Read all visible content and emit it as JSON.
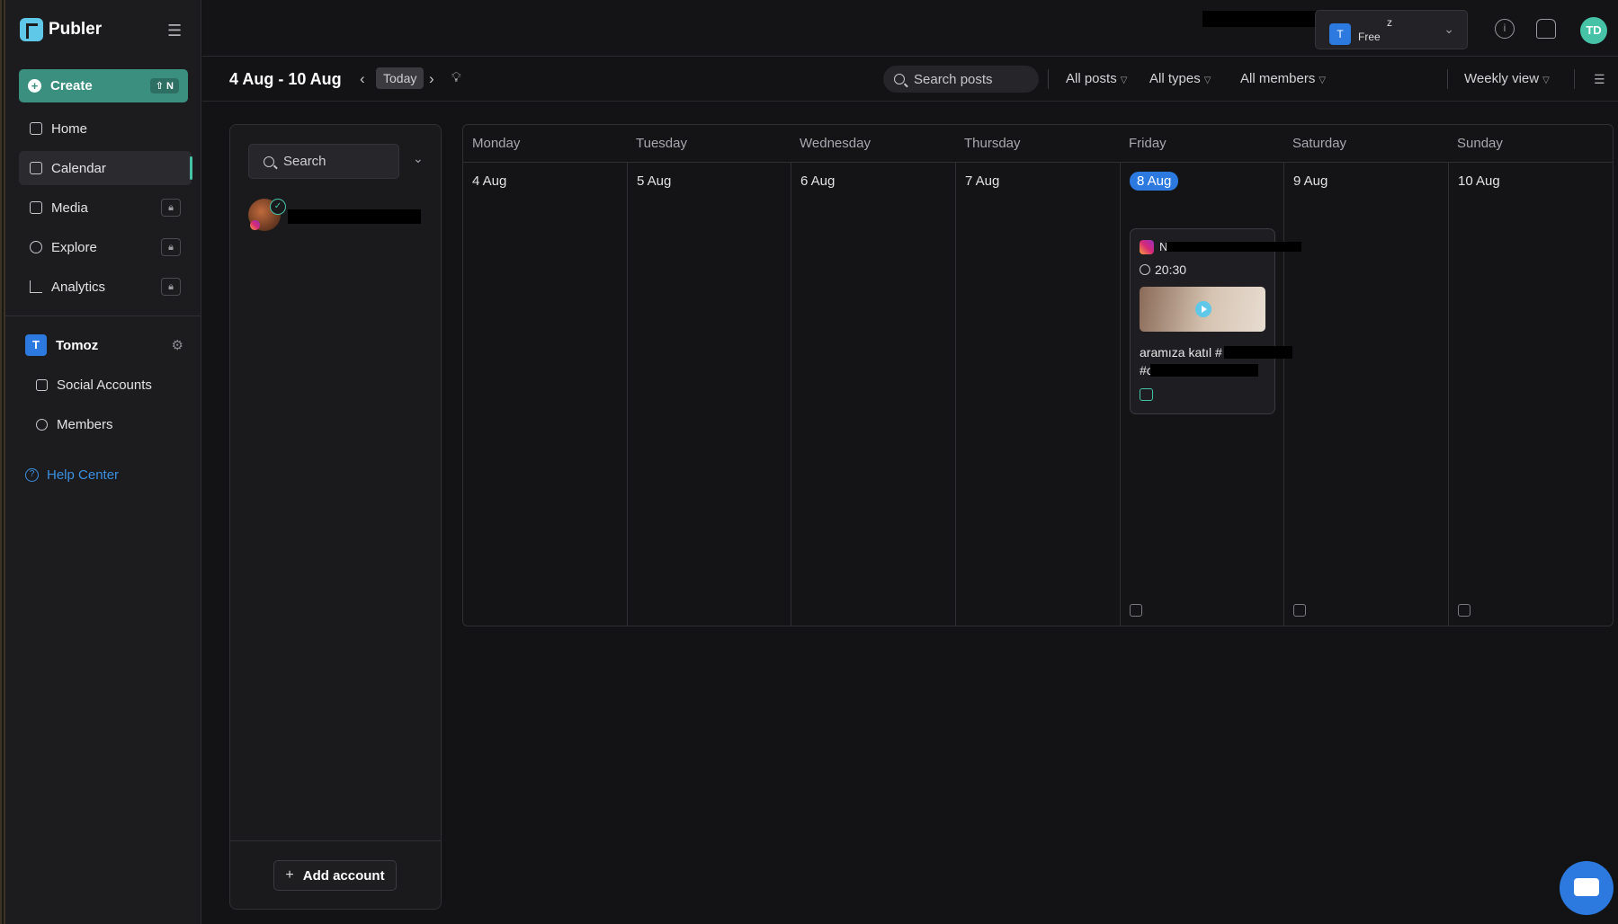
{
  "brand": {
    "name": "Publer"
  },
  "sidebar": {
    "create_label": "Create",
    "create_shortcut": "⇧ N",
    "items": [
      {
        "label": "Home",
        "icon": "home-icon",
        "locked": false
      },
      {
        "label": "Calendar",
        "icon": "calendar-icon",
        "locked": false,
        "active": true
      },
      {
        "label": "Media",
        "icon": "image-icon",
        "locked": true
      },
      {
        "label": "Explore",
        "icon": "compass-icon",
        "locked": true
      },
      {
        "label": "Analytics",
        "icon": "chart-icon",
        "locked": true
      }
    ],
    "workspace": {
      "initial": "T",
      "name": "Tomoz"
    },
    "sub_items": [
      {
        "label": "Social Accounts",
        "icon": "accounts-icon"
      },
      {
        "label": "Members",
        "icon": "members-icon"
      }
    ],
    "help_label": "Help Center"
  },
  "topbar": {
    "workspace_initial": "T",
    "workspace_name_fragment": "z",
    "workspace_plan": "Free",
    "avatar_initials": "TD"
  },
  "toolbar": {
    "range": "4 Aug - 10 Aug",
    "today_label": "Today",
    "search_placeholder": "Search posts",
    "filters": [
      "All posts",
      "All types",
      "All members",
      "Weekly view"
    ]
  },
  "accounts_panel": {
    "search_placeholder": "Search",
    "add_account_label": "Add account"
  },
  "calendar": {
    "days": [
      {
        "name": "Monday",
        "date": "4 Aug"
      },
      {
        "name": "Tuesday",
        "date": "5 Aug"
      },
      {
        "name": "Wednesday",
        "date": "6 Aug"
      },
      {
        "name": "Thursday",
        "date": "7 Aug"
      },
      {
        "name": "Friday",
        "date": "8 Aug",
        "today": true
      },
      {
        "name": "Saturday",
        "date": "9 Aug"
      },
      {
        "name": "Sunday",
        "date": "10 Aug"
      }
    ],
    "post": {
      "account_initial": "N",
      "time": "20:30",
      "caption_line1": "aramıza katıl #",
      "caption_line2": "#c"
    }
  },
  "colors": {
    "accent": "#46c3a7",
    "today": "#2c7ae0",
    "create": "#3a8f7f"
  }
}
